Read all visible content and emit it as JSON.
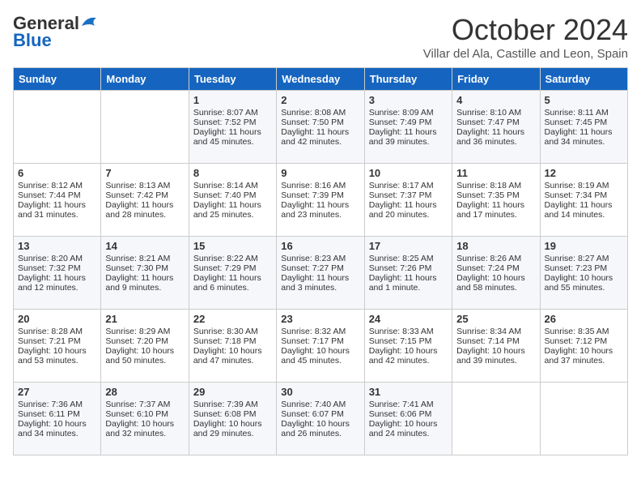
{
  "header": {
    "logo_general": "General",
    "logo_blue": "Blue",
    "month": "October 2024",
    "location": "Villar del Ala, Castille and Leon, Spain"
  },
  "days_of_week": [
    "Sunday",
    "Monday",
    "Tuesday",
    "Wednesday",
    "Thursday",
    "Friday",
    "Saturday"
  ],
  "weeks": [
    [
      {
        "day": "",
        "sunrise": "",
        "sunset": "",
        "daylight": ""
      },
      {
        "day": "",
        "sunrise": "",
        "sunset": "",
        "daylight": ""
      },
      {
        "day": "1",
        "sunrise": "Sunrise: 8:07 AM",
        "sunset": "Sunset: 7:52 PM",
        "daylight": "Daylight: 11 hours and 45 minutes."
      },
      {
        "day": "2",
        "sunrise": "Sunrise: 8:08 AM",
        "sunset": "Sunset: 7:50 PM",
        "daylight": "Daylight: 11 hours and 42 minutes."
      },
      {
        "day": "3",
        "sunrise": "Sunrise: 8:09 AM",
        "sunset": "Sunset: 7:49 PM",
        "daylight": "Daylight: 11 hours and 39 minutes."
      },
      {
        "day": "4",
        "sunrise": "Sunrise: 8:10 AM",
        "sunset": "Sunset: 7:47 PM",
        "daylight": "Daylight: 11 hours and 36 minutes."
      },
      {
        "day": "5",
        "sunrise": "Sunrise: 8:11 AM",
        "sunset": "Sunset: 7:45 PM",
        "daylight": "Daylight: 11 hours and 34 minutes."
      }
    ],
    [
      {
        "day": "6",
        "sunrise": "Sunrise: 8:12 AM",
        "sunset": "Sunset: 7:44 PM",
        "daylight": "Daylight: 11 hours and 31 minutes."
      },
      {
        "day": "7",
        "sunrise": "Sunrise: 8:13 AM",
        "sunset": "Sunset: 7:42 PM",
        "daylight": "Daylight: 11 hours and 28 minutes."
      },
      {
        "day": "8",
        "sunrise": "Sunrise: 8:14 AM",
        "sunset": "Sunset: 7:40 PM",
        "daylight": "Daylight: 11 hours and 25 minutes."
      },
      {
        "day": "9",
        "sunrise": "Sunrise: 8:16 AM",
        "sunset": "Sunset: 7:39 PM",
        "daylight": "Daylight: 11 hours and 23 minutes."
      },
      {
        "day": "10",
        "sunrise": "Sunrise: 8:17 AM",
        "sunset": "Sunset: 7:37 PM",
        "daylight": "Daylight: 11 hours and 20 minutes."
      },
      {
        "day": "11",
        "sunrise": "Sunrise: 8:18 AM",
        "sunset": "Sunset: 7:35 PM",
        "daylight": "Daylight: 11 hours and 17 minutes."
      },
      {
        "day": "12",
        "sunrise": "Sunrise: 8:19 AM",
        "sunset": "Sunset: 7:34 PM",
        "daylight": "Daylight: 11 hours and 14 minutes."
      }
    ],
    [
      {
        "day": "13",
        "sunrise": "Sunrise: 8:20 AM",
        "sunset": "Sunset: 7:32 PM",
        "daylight": "Daylight: 11 hours and 12 minutes."
      },
      {
        "day": "14",
        "sunrise": "Sunrise: 8:21 AM",
        "sunset": "Sunset: 7:30 PM",
        "daylight": "Daylight: 11 hours and 9 minutes."
      },
      {
        "day": "15",
        "sunrise": "Sunrise: 8:22 AM",
        "sunset": "Sunset: 7:29 PM",
        "daylight": "Daylight: 11 hours and 6 minutes."
      },
      {
        "day": "16",
        "sunrise": "Sunrise: 8:23 AM",
        "sunset": "Sunset: 7:27 PM",
        "daylight": "Daylight: 11 hours and 3 minutes."
      },
      {
        "day": "17",
        "sunrise": "Sunrise: 8:25 AM",
        "sunset": "Sunset: 7:26 PM",
        "daylight": "Daylight: 11 hours and 1 minute."
      },
      {
        "day": "18",
        "sunrise": "Sunrise: 8:26 AM",
        "sunset": "Sunset: 7:24 PM",
        "daylight": "Daylight: 10 hours and 58 minutes."
      },
      {
        "day": "19",
        "sunrise": "Sunrise: 8:27 AM",
        "sunset": "Sunset: 7:23 PM",
        "daylight": "Daylight: 10 hours and 55 minutes."
      }
    ],
    [
      {
        "day": "20",
        "sunrise": "Sunrise: 8:28 AM",
        "sunset": "Sunset: 7:21 PM",
        "daylight": "Daylight: 10 hours and 53 minutes."
      },
      {
        "day": "21",
        "sunrise": "Sunrise: 8:29 AM",
        "sunset": "Sunset: 7:20 PM",
        "daylight": "Daylight: 10 hours and 50 minutes."
      },
      {
        "day": "22",
        "sunrise": "Sunrise: 8:30 AM",
        "sunset": "Sunset: 7:18 PM",
        "daylight": "Daylight: 10 hours and 47 minutes."
      },
      {
        "day": "23",
        "sunrise": "Sunrise: 8:32 AM",
        "sunset": "Sunset: 7:17 PM",
        "daylight": "Daylight: 10 hours and 45 minutes."
      },
      {
        "day": "24",
        "sunrise": "Sunrise: 8:33 AM",
        "sunset": "Sunset: 7:15 PM",
        "daylight": "Daylight: 10 hours and 42 minutes."
      },
      {
        "day": "25",
        "sunrise": "Sunrise: 8:34 AM",
        "sunset": "Sunset: 7:14 PM",
        "daylight": "Daylight: 10 hours and 39 minutes."
      },
      {
        "day": "26",
        "sunrise": "Sunrise: 8:35 AM",
        "sunset": "Sunset: 7:12 PM",
        "daylight": "Daylight: 10 hours and 37 minutes."
      }
    ],
    [
      {
        "day": "27",
        "sunrise": "Sunrise: 7:36 AM",
        "sunset": "Sunset: 6:11 PM",
        "daylight": "Daylight: 10 hours and 34 minutes."
      },
      {
        "day": "28",
        "sunrise": "Sunrise: 7:37 AM",
        "sunset": "Sunset: 6:10 PM",
        "daylight": "Daylight: 10 hours and 32 minutes."
      },
      {
        "day": "29",
        "sunrise": "Sunrise: 7:39 AM",
        "sunset": "Sunset: 6:08 PM",
        "daylight": "Daylight: 10 hours and 29 minutes."
      },
      {
        "day": "30",
        "sunrise": "Sunrise: 7:40 AM",
        "sunset": "Sunset: 6:07 PM",
        "daylight": "Daylight: 10 hours and 26 minutes."
      },
      {
        "day": "31",
        "sunrise": "Sunrise: 7:41 AM",
        "sunset": "Sunset: 6:06 PM",
        "daylight": "Daylight: 10 hours and 24 minutes."
      },
      {
        "day": "",
        "sunrise": "",
        "sunset": "",
        "daylight": ""
      },
      {
        "day": "",
        "sunrise": "",
        "sunset": "",
        "daylight": ""
      }
    ]
  ]
}
